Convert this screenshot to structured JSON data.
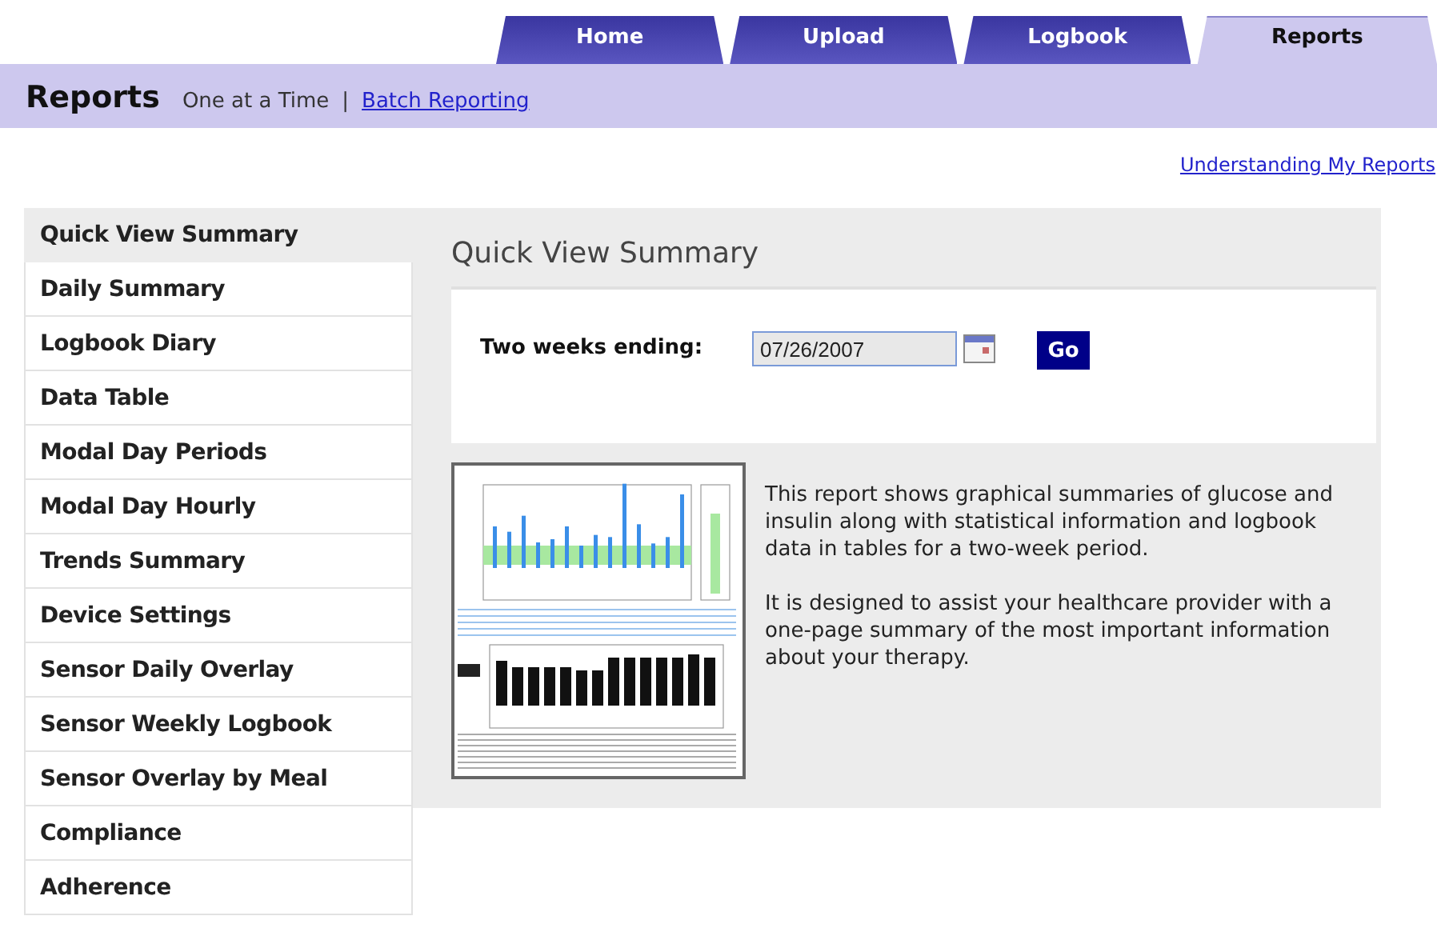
{
  "tabs": [
    {
      "label": "Home",
      "selected": false
    },
    {
      "label": "Upload",
      "selected": false
    },
    {
      "label": "Logbook",
      "selected": false
    },
    {
      "label": "Reports",
      "selected": true
    }
  ],
  "header": {
    "title": "Reports",
    "current": "One at a Time",
    "separator": "|",
    "link": "Batch Reporting"
  },
  "help_link": "Understanding My Reports",
  "sidebar": {
    "items": [
      {
        "label": "Quick View Summary",
        "selected": true
      },
      {
        "label": "Daily Summary",
        "selected": false
      },
      {
        "label": "Logbook Diary",
        "selected": false
      },
      {
        "label": "Data Table",
        "selected": false
      },
      {
        "label": "Modal Day Periods",
        "selected": false
      },
      {
        "label": "Modal Day Hourly",
        "selected": false
      },
      {
        "label": "Trends Summary",
        "selected": false
      },
      {
        "label": "Device Settings",
        "selected": false
      },
      {
        "label": "Sensor Daily Overlay",
        "selected": false
      },
      {
        "label": "Sensor Weekly Logbook",
        "selected": false
      },
      {
        "label": "Sensor Overlay by Meal",
        "selected": false
      },
      {
        "label": "Compliance",
        "selected": false
      },
      {
        "label": "Adherence",
        "selected": false
      }
    ]
  },
  "panel": {
    "title": "Quick View Summary",
    "date_label": "Two weeks ending:",
    "date_value": "07/26/2007",
    "go_button": "Go",
    "description": [
      "This report shows graphical summaries of glucose and insulin along with statistical information and logbook data in tables for a two-week period.",
      "It is designed to assist your healthcare provider with a one-page summary of the most important information about your therapy."
    ]
  }
}
